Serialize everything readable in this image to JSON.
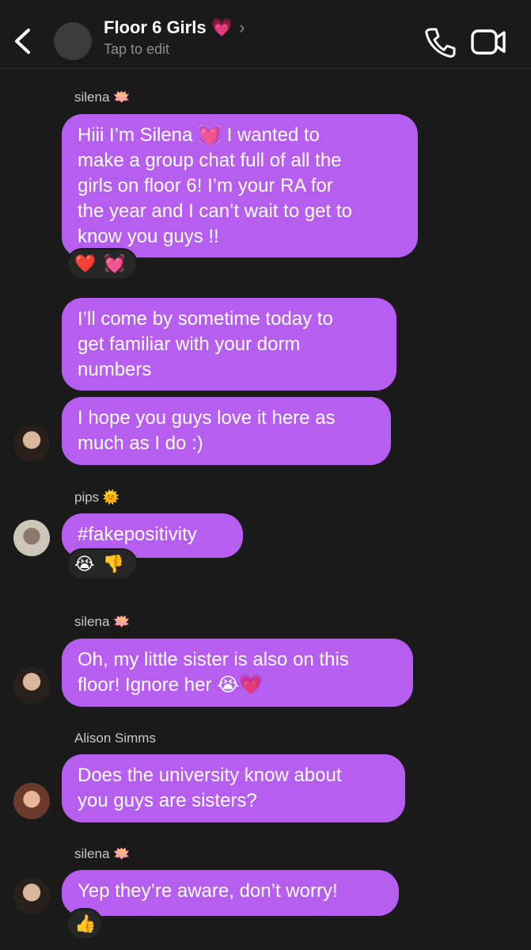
{
  "header": {
    "title": "Floor 6 Girls 💗",
    "subtitle": "Tap to edit",
    "back_icon": "chevron-left-icon",
    "call_icon": "phone-icon",
    "video_icon": "video-camera-icon"
  },
  "colors": {
    "background": "#1a1a1a",
    "bubble": "#b65ef0",
    "reaction_pill": "#262626",
    "secondary_text": "#8e8e8e"
  },
  "messages": [
    {
      "sender": "silena 🪷",
      "lines": [
        "Hiii I’m Silena 💓 I wanted to",
        "make a group chat full of all the",
        "girls on floor 6! I’m your RA for",
        "the year and I can’t wait to get to",
        "know you guys !!"
      ],
      "reactions": [
        "❤️",
        "💓"
      ]
    },
    {
      "lines": [
        "I’ll come by sometime today to",
        "get familiar with your dorm",
        "numbers"
      ]
    },
    {
      "lines": [
        "I hope you guys love it here as",
        "much as I do :)"
      ]
    },
    {
      "sender": "pips 🌞",
      "lines": [
        "#fakepositivity"
      ],
      "reactions": [
        "😭",
        "👎"
      ]
    },
    {
      "sender": "silena 🪷",
      "lines": [
        "Oh, my little sister is also on this",
        "floor! Ignore her 😭💗"
      ]
    },
    {
      "sender": "Alison Simms",
      "lines": [
        "Does the university know about",
        "you guys are sisters?"
      ]
    },
    {
      "sender": "silena 🪷",
      "lines": [
        "Yep they’re aware, don’t worry!"
      ],
      "reactions": [
        "👍"
      ]
    }
  ]
}
